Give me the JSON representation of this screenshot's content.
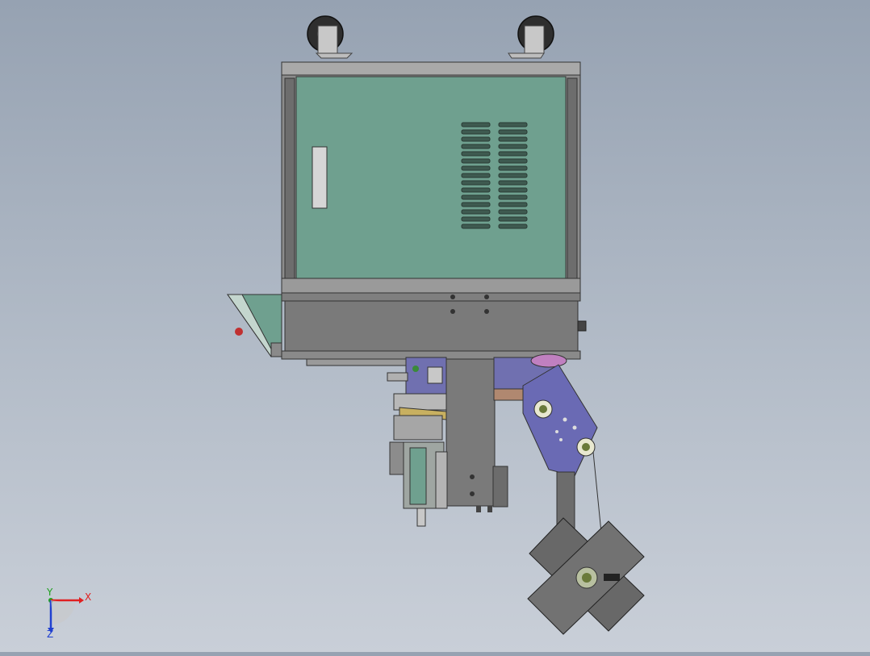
{
  "viewport": {
    "model_view": "machine-assembly-bottom-view"
  },
  "triad": {
    "x_label": "X",
    "y_label": "Y",
    "z_label": "Z",
    "colors": {
      "x": "#e02020",
      "y": "#20a020",
      "z": "#2040d0"
    }
  },
  "colors": {
    "background_top": "#96a2b2",
    "background_bottom": "#c9cfd8",
    "cabinet_panel": "#6fa08f",
    "cabinet_frame": "#8c8c8c",
    "column": "#7a7a7a",
    "arm": "#6a6ab4",
    "mount_plate": "#6a6a6a"
  }
}
